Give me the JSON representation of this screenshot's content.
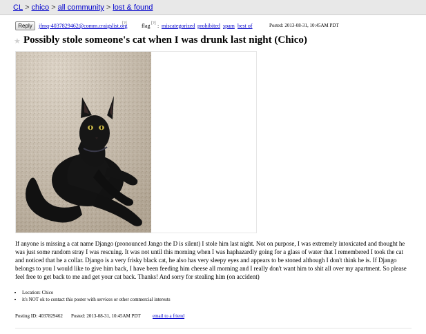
{
  "breadcrumb": {
    "items": [
      "CL",
      "chico",
      "all community",
      "lost & found"
    ],
    "separator": ">"
  },
  "actions": {
    "reply_label": "Reply",
    "reply_email": "jfmq-4037829462@comm.craigslist.org",
    "reply_info": "[?]",
    "flag_label": "flag",
    "flag_help": "[?]",
    "flag_colon": ":",
    "flag_options": [
      "miscategorized",
      "prohibited",
      "spam",
      "best of"
    ],
    "posted": "Posted: 2013-08-31, 10:45AM PDT"
  },
  "post": {
    "title": "Possibly stole someone's cat when I was drunk last night (Chico)",
    "body": "If anyone is missing a cat name Django (pronounced Jango the D is silent) I stole him last night. Not on purpose, I was extremely intoxicated and thought he was just some random stray I was rescuing. It was not until this morning when I was haphazardly going for a glass of water that I remembered I took the cat and noticed that he a collar. Django is a very frisky black cat, he also has very sleepy eyes and appears to be stoned although I don't think he is. If Django belongs to you I would like to give him back, I have been feeding him cheese all morning and I really don't want him to shit all over my apartment. So please feel free to get back to me and get your cat back. Thanks! And sorry for stealing him (on accident)",
    "notices": [
      "Location: Chico",
      "it's NOT ok to contact this poster with services or other commercial interests"
    ]
  },
  "footer": {
    "posting_id": "Posting ID: 4037829462",
    "posted": "Posted: 2013-08-31, 10:45AM PDT",
    "email_friend": "email to a friend"
  },
  "colors": {
    "link": "#0000cc",
    "topbar": "#e8e8e8"
  },
  "icons": {
    "favorite": "star-icon"
  }
}
